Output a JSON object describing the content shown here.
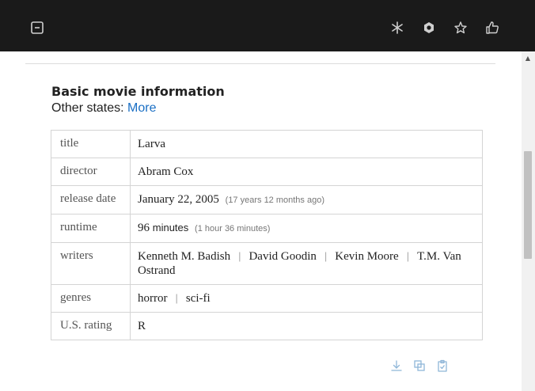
{
  "toolbar": {
    "left_icon": "minus-square-icon",
    "right_icons": [
      "asterisk-icon",
      "hexagon-icon",
      "star-icon",
      "thumbs-up-icon"
    ]
  },
  "section": {
    "heading": "Basic movie information",
    "states_prefix": "Other states:",
    "states_link": "More"
  },
  "movie": {
    "rows": {
      "title": {
        "key": "title",
        "value": "Larva"
      },
      "director": {
        "key": "director",
        "value": "Abram Cox"
      },
      "release": {
        "key": "release date",
        "value": "January 22, 2005",
        "note": "(17 years  12 months ago)"
      },
      "runtime": {
        "key": "runtime",
        "value": "96",
        "unit": "minutes",
        "note": "(1 hour 36 minutes)"
      },
      "writers": {
        "key": "writers",
        "values": [
          "Kenneth M. Badish",
          "David Goodin",
          "Kevin Moore",
          "T.M. Van Ostrand"
        ],
        "separator": "|"
      },
      "genres": {
        "key": "genres",
        "values": [
          "horror",
          "sci-fi"
        ],
        "separator": "|"
      },
      "rating": {
        "key": "U.S. rating",
        "value": "R"
      }
    }
  },
  "actions": [
    "download-icon",
    "copy-icon",
    "clipboard-check-icon"
  ],
  "colors": {
    "topbar": "#1a1a1a",
    "link": "#1a6fc4"
  }
}
